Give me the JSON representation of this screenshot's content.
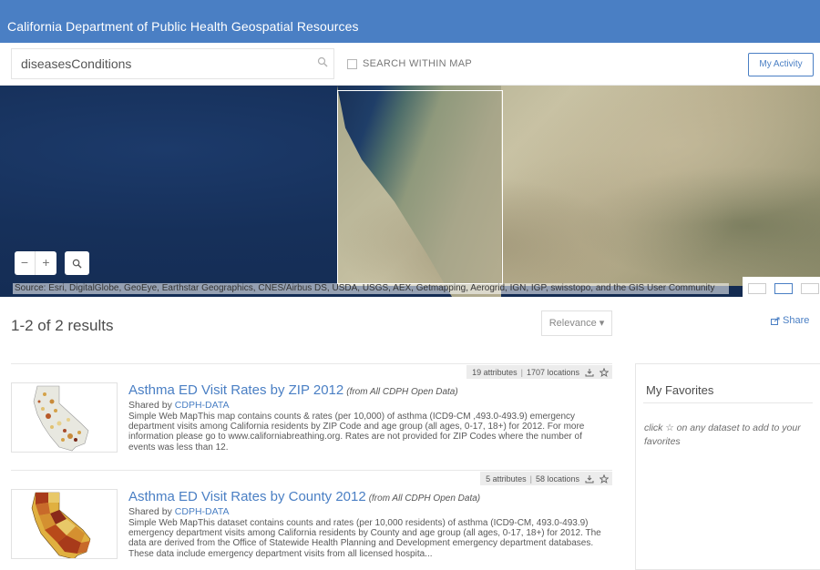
{
  "header": {
    "title": "California Department of Public Health Geospatial Resources"
  },
  "search": {
    "value": "diseasesConditions",
    "search_within_map_label": "SEARCH WITHIN MAP",
    "my_activity_label": "My Activity"
  },
  "map": {
    "zoom_out": "−",
    "zoom_in": "+",
    "attribution": "Source: Esri, DigitalGlobe, GeoEye, Earthstar Geographics, CNES/Airbus DS, USDA, USGS, AEX, Getmapping, Aerogrid, IGN, IGP, swisstopo, and the GIS User Community"
  },
  "results": {
    "count_label": "1-2 of 2 results",
    "sort_label": "Relevance ▾",
    "share_label": "Share"
  },
  "items": [
    {
      "attributes": "19 attributes",
      "locations": "1707 locations",
      "title": "Asthma ED Visit Rates by ZIP 2012",
      "source": "(from All CDPH Open Data)",
      "shared_by": "Shared by ",
      "owner": "CDPH-DATA",
      "description": "Simple Web MapThis map contains counts & rates (per 10,000) of asthma (ICD9-CM ,493.0-493.9) emergency department visits among California residents by ZIP Code and age group (all ages, 0-17, 18+) for 2012. For more information please go to www.californiabreathing.org. Rates are not provided for ZIP Codes where the number of events was less than 12."
    },
    {
      "attributes": "5 attributes",
      "locations": "58 locations",
      "title": "Asthma ED Visit Rates by County 2012",
      "source": "(from All CDPH Open Data)",
      "shared_by": "Shared by ",
      "owner": "CDPH-DATA",
      "description": "Simple Web MapThis dataset contains counts and rates (per 10,000 residents) of asthma (ICD9-CM, 493.0-493.9) emergency department visits among California residents by County and age group (all ages, 0-17, 18+) for 2012. The data are derived from the Office of Statewide Health Planning and Development emergency department databases. These data include emergency department visits from all licensed hospita..."
    }
  ],
  "favorites": {
    "title": "My Favorites",
    "hint_prefix": "click ",
    "hint_star": "☆",
    "hint_suffix": " on any dataset to add to your favorites"
  },
  "colors": {
    "header_bg": "#4a7fc4",
    "link": "#4a7fc4",
    "text": "#4c4c4c"
  }
}
